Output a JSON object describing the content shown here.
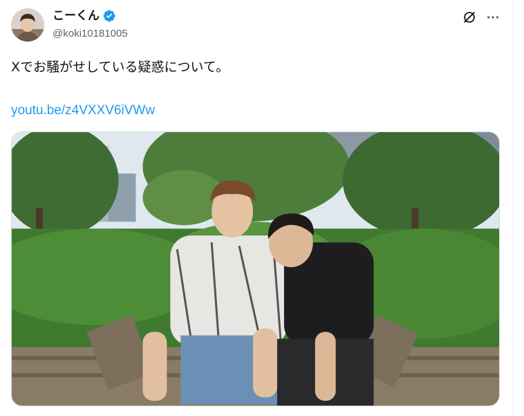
{
  "author": {
    "display_name": "こーくん",
    "handle": "@koki10181005",
    "verified_icon": "verified-badge-icon",
    "verified_color": "#1d9bf0"
  },
  "actions": {
    "grok_icon": "grok-icon",
    "more_icon": "more-horizontal-icon"
  },
  "tweet": {
    "text": "Xでお騒がせしている疑惑について。",
    "link": "youtu.be/z4VXXV6iVWw",
    "link_color": "#1d9bf0"
  }
}
